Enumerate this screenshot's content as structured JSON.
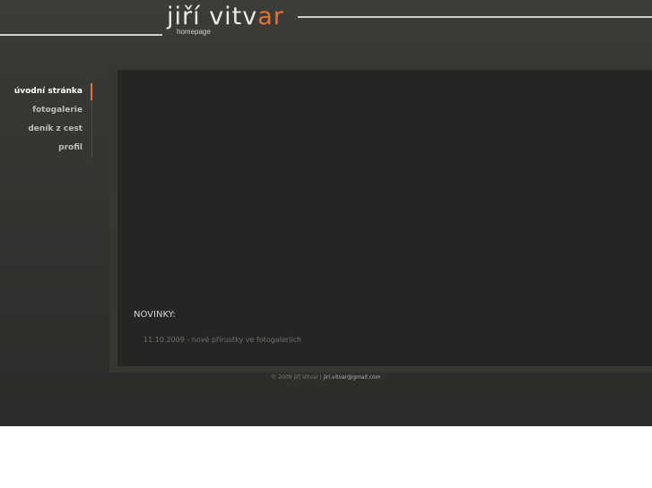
{
  "header": {
    "logo_main": "jiří vitv",
    "logo_accent": "ar",
    "logo_sub": "homepage"
  },
  "nav": {
    "items": [
      {
        "label": "úvodní stránka",
        "active": true
      },
      {
        "label": "fotogalerie",
        "active": false
      },
      {
        "label": "deník z cest",
        "active": false
      },
      {
        "label": "profil",
        "active": false
      }
    ]
  },
  "news": {
    "title": "NOVINKY:",
    "items": [
      "11.10.2009 - nové přírustky ve fotogaleriích"
    ]
  },
  "footer": {
    "copyright": "© 2009 Jiří Vitvar | ",
    "email": "jiri.vitvar@gmail.com"
  },
  "colors": {
    "accent": "#e8702a",
    "background": "#383935",
    "content": "#252624"
  }
}
